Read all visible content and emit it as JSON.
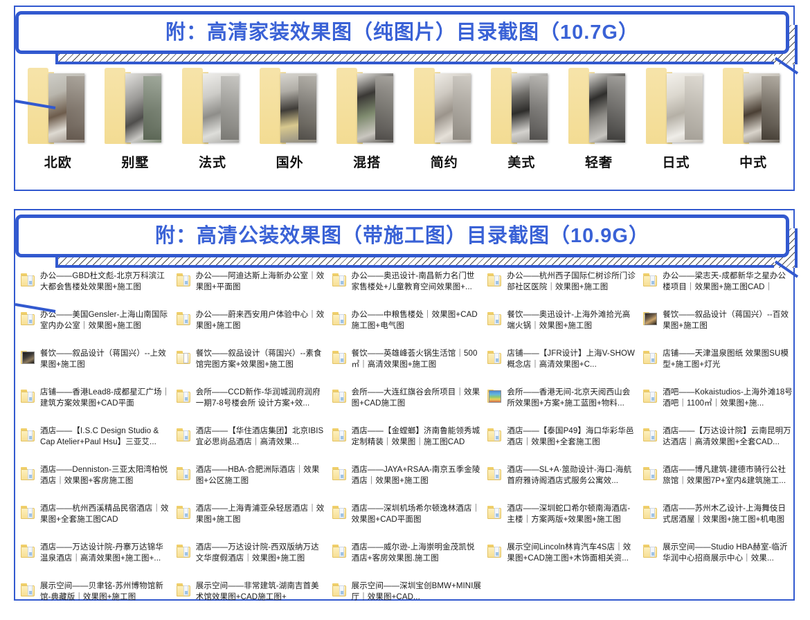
{
  "colors": {
    "accent": "#3259cf",
    "title_text": "#3a62d6",
    "folder_yellow": "#f6e3a8",
    "list_text": "#1b1b1b"
  },
  "section_one": {
    "banner_title": "附：高清家装效果图（纯图片）目录截图（10.7G）",
    "folders": [
      {
        "label": "北欧",
        "icon": "photo-folder-icon"
      },
      {
        "label": "别墅",
        "icon": "photo-folder-icon"
      },
      {
        "label": "法式",
        "icon": "photo-folder-icon"
      },
      {
        "label": "国外",
        "icon": "photo-folder-icon"
      },
      {
        "label": "混搭",
        "icon": "photo-folder-icon"
      },
      {
        "label": "简约",
        "icon": "photo-folder-icon"
      },
      {
        "label": "美式",
        "icon": "photo-folder-icon"
      },
      {
        "label": "轻奢",
        "icon": "photo-folder-icon"
      },
      {
        "label": "日式",
        "icon": "photo-folder-icon"
      },
      {
        "label": "中式",
        "icon": "photo-folder-icon"
      }
    ]
  },
  "section_two": {
    "banner_title": "附：高清公装效果图（带施工图）目录截图（10.9G）",
    "columns": [
      {
        "items": [
          {
            "icon": "folder-icon",
            "text": "办公——GBD杜文彪-北京万科滨江大都会售楼处效果图+施工图"
          },
          {
            "icon": "folder-icon",
            "text": "办公——美国Gensler-上海山南国际室内办公室｜效果图+施工图"
          },
          {
            "icon": "folder-thumbnail-icon",
            "text": "餐饮——叙品设计（蒋国兴）--上效果图+施工图"
          },
          {
            "icon": "folder-icon",
            "text": "店铺——香港Lead8-成都星汇广场｜建筑方案效果图+CAD平面"
          },
          {
            "icon": "folder-icon",
            "text": "酒店——【I.S.C Design Studio & Cap Atelier+Paul Hsu】三亚艾..."
          },
          {
            "icon": "folder-icon",
            "text": "酒店——Denniston-三亚太阳湾柏悦酒店｜效果图+客房施工图"
          },
          {
            "icon": "folder-icon",
            "text": "酒店——杭州西溪精品民宿酒店｜效果图+全套施工图CAD"
          },
          {
            "icon": "folder-icon",
            "text": "酒店——万达设计院-丹寨万达锦华温泉酒店｜高清效果图+施工图+..."
          },
          {
            "icon": "folder-icon",
            "text": "展示空间——贝聿铭-苏州博物馆新馆-典藏版｜效果图+施工图"
          }
        ]
      },
      {
        "items": [
          {
            "icon": "folder-icon",
            "text": "办公——阿迪达斯上海新办公室｜效果图+平面图"
          },
          {
            "icon": "folder-icon",
            "text": "办公——蔚来西安用户体验中心｜效果图+施工图"
          },
          {
            "icon": "folder-open-icon",
            "text": "餐饮——叙品设计（蒋国兴）--素食馆完图方案+效果图+施工图"
          },
          {
            "icon": "folder-icon",
            "text": "会所——CCD新作-华润城润府润府一期7-8号楼会所 设计方案+效..."
          },
          {
            "icon": "folder-icon",
            "text": "酒店——【华住酒店集团】北京IBIS宜必思尚品酒店｜高清效果..."
          },
          {
            "icon": "folder-icon",
            "text": "酒店——HBA-合肥洲际酒店｜效果图+公区施工图"
          },
          {
            "icon": "folder-icon",
            "text": "酒店——上海青浦亚朵轻居酒店｜效果图+施工图"
          },
          {
            "icon": "folder-icon",
            "text": "酒店——万达设计院-西双版纳万达文华度假酒店｜效果图+施工图"
          },
          {
            "icon": "folder-icon",
            "text": "展示空间——非常建筑-湖南吉首美术馆效果图+CAD施工图+"
          }
        ]
      },
      {
        "items": [
          {
            "icon": "folder-icon",
            "text": "办公——奥迅设计-南昌新力名门世家售楼处+儿童教育空间效果图+..."
          },
          {
            "icon": "folder-icon",
            "text": "办公——中粮售楼处｜效果图+CAD施工图+电气图"
          },
          {
            "icon": "folder-icon",
            "text": "餐饮——英雄峰荟火锅生活馆｜500㎡｜高清效果图+施工图"
          },
          {
            "icon": "folder-icon",
            "text": "会所——大连红旗谷会所项目｜效果图+CAD施工图"
          },
          {
            "icon": "folder-icon",
            "text": "酒店——【金螳螂】济南鲁能领秀城定制精装｜效果图｜施工图CAD"
          },
          {
            "icon": "folder-icon",
            "text": "酒店——JAYA+RSAA-南京五季金陵酒店｜效果图+施工图"
          },
          {
            "icon": "folder-icon",
            "text": "酒店——深圳机场希尔顿逸林酒店｜效果图+CAD平面图"
          },
          {
            "icon": "folder-icon",
            "text": "酒店——威尔逊-上海崇明金茂凯悦酒店+客房效果图.施工图"
          },
          {
            "icon": "folder-icon",
            "text": "展示空间——深圳宝创BMW+MINI展厅｜效果图+CAD..."
          }
        ]
      },
      {
        "items": [
          {
            "icon": "folder-icon",
            "text": "办公——杭州西子国际仁树诊所门诊部社区医院｜效果图+施工图"
          },
          {
            "icon": "folder-icon",
            "text": "餐饮——奥迅设计-上海外滩拾光高端火锅｜效果图+施工图"
          },
          {
            "icon": "folder-icon",
            "text": "店铺——【JFR设计】上海V-SHOW概念店｜高清效果图+C..."
          },
          {
            "icon": "folder-colorful-icon",
            "text": "会所——香港无间-北京天阅西山会所效果图+方案+施工蓝图+物料..."
          },
          {
            "icon": "folder-icon",
            "text": "酒店——【泰国P49】海口华彩华邑酒店｜效果图+全套施工图"
          },
          {
            "icon": "folder-icon",
            "text": "酒店——SL+A·筮勋设计-海口-海航首府雅诗阁酒店式服务公寓效..."
          },
          {
            "icon": "folder-icon",
            "text": "酒店——深圳蛇口希尔顿南海酒店-主楼｜方案两版+效果图+施工图"
          },
          {
            "icon": "folder-icon",
            "text": "展示空间Lincoln林肯汽车4S店｜效果图+CAD施工图+木饰面相关资..."
          }
        ]
      },
      {
        "items": [
          {
            "icon": "folder-icon",
            "text": "办公——梁志天-成都新华之星办公楼项目｜效果图+施工图CAD｜"
          },
          {
            "icon": "folder-thumbnail-icon",
            "text": "餐饮——叙品设计（蒋国兴）--百效果图+施工图"
          },
          {
            "icon": "folder-icon",
            "text": "店铺——天津温泉图纸 效果图SU模型+施工图+灯光"
          },
          {
            "icon": "folder-icon",
            "text": "酒吧——Kokaistudios-上海外滩18号酒吧｜1100㎡｜效果图+施..."
          },
          {
            "icon": "folder-icon",
            "text": "酒店——【万达设计院】云南昆明万达酒店｜高清效果图+全套CAD..."
          },
          {
            "icon": "folder-icon",
            "text": "酒店——博凡建筑-建德市骑行公社旅馆｜效果图7P+室内&建筑施工..."
          },
          {
            "icon": "folder-icon",
            "text": "酒店——苏州木乙设计-上海舞伎日式居酒屋｜效果图+施工图+机电图"
          },
          {
            "icon": "folder-icon",
            "text": "展示空间——Studio HBA赫室-临沂华润中心招商展示中心｜效果..."
          }
        ]
      }
    ]
  }
}
